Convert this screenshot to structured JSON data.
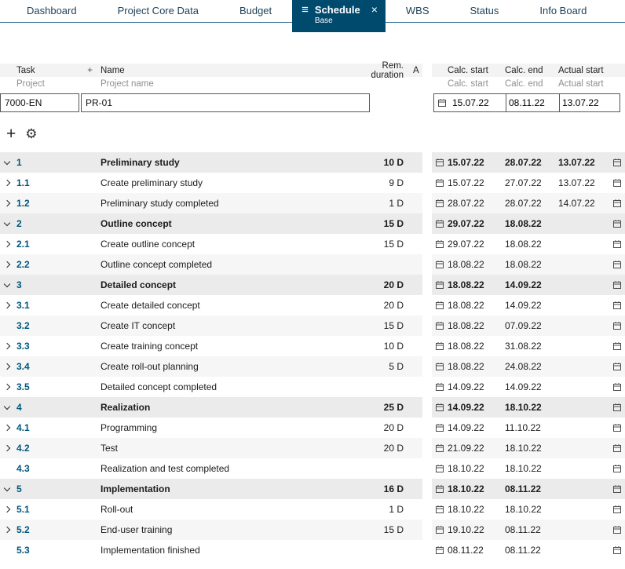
{
  "tabs": [
    {
      "label": "Dashboard"
    },
    {
      "label": "Project Core Data"
    },
    {
      "label": "Budget"
    },
    {
      "label": "Schedule",
      "active": true,
      "sub": "Base"
    },
    {
      "label": "WBS"
    },
    {
      "label": "Status"
    },
    {
      "label": "Info Board"
    }
  ],
  "icons": {
    "hamburger": "≡",
    "close": "×",
    "plus": "+",
    "gear": "⚙"
  },
  "colors": {
    "active_tab": "#004a6e",
    "task_number": "#00567c"
  },
  "header": {
    "task": "Task",
    "plus": "+",
    "name": "Name",
    "rem_duration": "Rem. duration",
    "a": "A",
    "calc_start": "Calc. start",
    "calc_end": "Calc. end",
    "actual_start": "Actual start"
  },
  "subheader": {
    "project": "Project",
    "project_name": "Project name",
    "calc_start": "Calc. start",
    "calc_end": "Calc. end",
    "actual_start": "Actual start"
  },
  "project": {
    "id": "7000-EN",
    "name": "PR-01",
    "calc_start": "15.07.22",
    "calc_end": "08.11.22",
    "actual_start": "13.07.22"
  },
  "rows": [
    {
      "id": "1",
      "name": "Preliminary study",
      "dur": "10 D",
      "calc_start": "15.07.22",
      "calc_end": "28.07.22",
      "actual_start": "13.07.22",
      "group": true,
      "chevron": "down"
    },
    {
      "id": "1.1",
      "name": "Create preliminary study",
      "dur": "9 D",
      "calc_start": "15.07.22",
      "calc_end": "27.07.22",
      "actual_start": "13.07.22",
      "chevron": "right"
    },
    {
      "id": "1.2",
      "name": "Preliminary study completed",
      "dur": "1 D",
      "calc_start": "28.07.22",
      "calc_end": "28.07.22",
      "actual_start": "14.07.22",
      "chevron": "right",
      "shade": true
    },
    {
      "id": "2",
      "name": "Outline concept",
      "dur": "15 D",
      "calc_start": "29.07.22",
      "calc_end": "18.08.22",
      "group": true,
      "chevron": "down"
    },
    {
      "id": "2.1",
      "name": "Create outline concept",
      "dur": "15 D",
      "calc_start": "29.07.22",
      "calc_end": "18.08.22",
      "chevron": "right"
    },
    {
      "id": "2.2",
      "name": "Outline concept completed",
      "dur": "",
      "calc_start": "18.08.22",
      "calc_end": "18.08.22",
      "chevron": "right",
      "shade": true
    },
    {
      "id": "3",
      "name": "Detailed concept",
      "dur": "20 D",
      "calc_start": "18.08.22",
      "calc_end": "14.09.22",
      "group": true,
      "chevron": "down"
    },
    {
      "id": "3.1",
      "name": "Create detailed concept",
      "dur": "20 D",
      "calc_start": "18.08.22",
      "calc_end": "14.09.22",
      "chevron": "right"
    },
    {
      "id": "3.2",
      "name": "Create IT concept",
      "dur": "15 D",
      "calc_start": "18.08.22",
      "calc_end": "07.09.22",
      "shade": true
    },
    {
      "id": "3.3",
      "name": "Create training concept",
      "dur": "10 D",
      "calc_start": "18.08.22",
      "calc_end": "31.08.22",
      "chevron": "right"
    },
    {
      "id": "3.4",
      "name": "Create roll-out planning",
      "dur": "5 D",
      "calc_start": "18.08.22",
      "calc_end": "24.08.22",
      "chevron": "right",
      "shade": true
    },
    {
      "id": "3.5",
      "name": "Detailed concept completed",
      "dur": "",
      "calc_start": "14.09.22",
      "calc_end": "14.09.22",
      "chevron": "right"
    },
    {
      "id": "4",
      "name": "Realization",
      "dur": "25 D",
      "calc_start": "14.09.22",
      "calc_end": "18.10.22",
      "group": true,
      "chevron": "down"
    },
    {
      "id": "4.1",
      "name": "Programming",
      "dur": "20 D",
      "calc_start": "14.09.22",
      "calc_end": "11.10.22",
      "chevron": "right"
    },
    {
      "id": "4.2",
      "name": "Test",
      "dur": "20 D",
      "calc_start": "21.09.22",
      "calc_end": "18.10.22",
      "chevron": "right",
      "shade": true
    },
    {
      "id": "4.3",
      "name": "Realization and test completed",
      "dur": "",
      "calc_start": "18.10.22",
      "calc_end": "18.10.22"
    },
    {
      "id": "5",
      "name": "Implementation",
      "dur": "16 D",
      "calc_start": "18.10.22",
      "calc_end": "08.11.22",
      "group": true,
      "chevron": "down"
    },
    {
      "id": "5.1",
      "name": "Roll-out",
      "dur": "1 D",
      "calc_start": "18.10.22",
      "calc_end": "18.10.22",
      "chevron": "right"
    },
    {
      "id": "5.2",
      "name": "End-user training",
      "dur": "15 D",
      "calc_start": "19.10.22",
      "calc_end": "08.11.22",
      "chevron": "right",
      "shade": true
    },
    {
      "id": "5.3",
      "name": "Implementation finished",
      "dur": "",
      "calc_start": "08.11.22",
      "calc_end": "08.11.22"
    }
  ]
}
